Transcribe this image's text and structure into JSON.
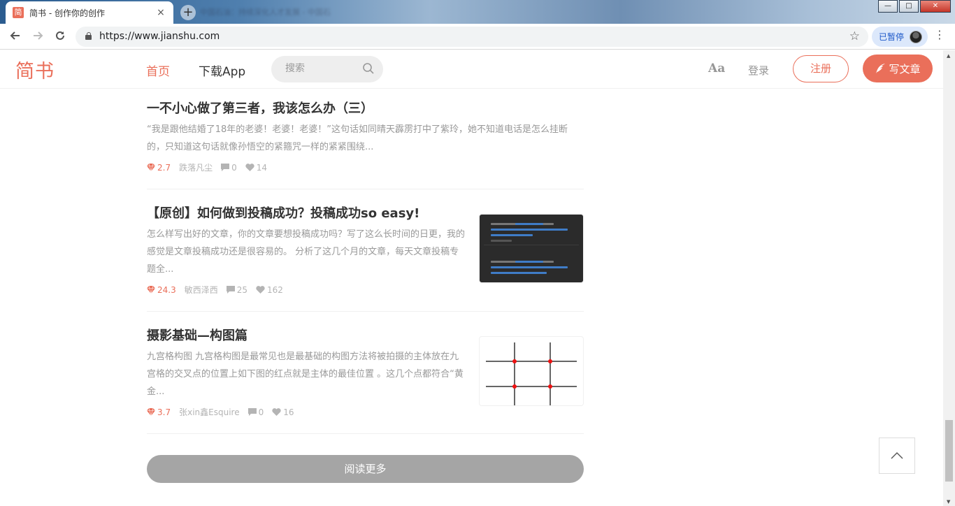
{
  "browser": {
    "tab_favicon": "简",
    "tab_title": "简书 - 创作你的创作",
    "tab_close": "×",
    "new_tab": "+",
    "background_tab_title": "中国石油：持续深化人才发展 - 中国石",
    "window_controls": {
      "minimize": "—",
      "maximize": "□",
      "close": "✕"
    },
    "url": "https://www.jianshu.com",
    "profile_label": "已暂停",
    "icons": [
      "back-arrow-icon",
      "forward-arrow-icon",
      "reload-icon",
      "lock-icon",
      "bookmark-star-icon",
      "profile-avatar",
      "kebab-menu-icon"
    ]
  },
  "header": {
    "logo": "简书",
    "nav_home": "首页",
    "nav_app": "下载App",
    "search_placeholder": "搜索",
    "aa": "Aa",
    "login": "登录",
    "signup": "注册",
    "write": "写文章"
  },
  "articles": [
    {
      "title": "一不小心做了第三者，我该怎么办（三）",
      "abstract": "“我是跟他结婚了18年的老婆！老婆！老婆！”这句话如同晴天霹雳打中了紫玲，她不知道电话是怎么挂断的，只知道这句话就像孙悟空的紧箍咒一样的紧紧围绕...",
      "diamond": "2.7",
      "author": "跌落凡尘",
      "comments": "0",
      "likes": "14",
      "thumbnail": null
    },
    {
      "title": "【原创】如何做到投稿成功？投稿成功so easy!",
      "abstract": "怎么样写出好的文章，你的文章要想投稿成功吗？写了这么长时间的日更，我的感觉是文章投稿成功还是很容易的。 分析了这几个月的文章，每天文章投稿专题全...",
      "diamond": "24.3",
      "author": "敏西泽西",
      "comments": "25",
      "likes": "162",
      "thumbnail": "dark-notification-screenshot"
    },
    {
      "title": "摄影基础—构图篇",
      "abstract": "九宫格构图 九宫格构图是最常见也是最基础的构图方法将被拍摄的主体放在九宫格的交叉点的位置上如下图的红点就是主体的最佳位置 。这几个点都符合“黄金...",
      "diamond": "3.7",
      "author": "张xin鑫Esquire",
      "comments": "0",
      "likes": "16",
      "thumbnail": "rule-of-thirds-grid"
    }
  ],
  "read_more": "阅读更多",
  "colors": {
    "brand": "#ea6f5a",
    "read_more_bg": "#a5a5a5",
    "meta_gray": "#b4b4b4",
    "abstract_gray": "#999999"
  }
}
